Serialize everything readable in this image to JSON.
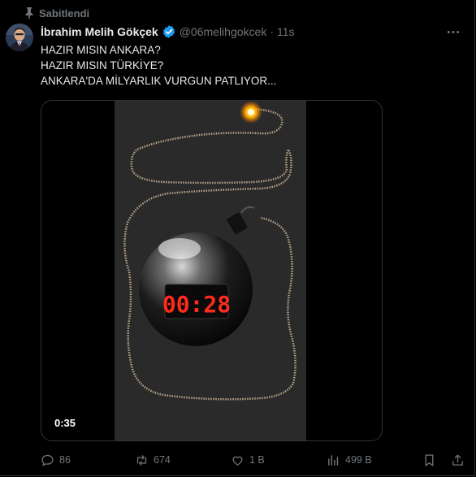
{
  "post": {
    "pinned_label": "Sabitlendi",
    "author_name": "İbrahim Melih Gökçek",
    "handle": "@06melihgokcek",
    "separator": "·",
    "time": "11s",
    "text_lines": [
      "HAZIR MISIN ANKARA?",
      "HAZIR MISIN TÜRKİYE?",
      "ANKARA'DA MİLYARLIK VURGUN PATLIYOR..."
    ]
  },
  "media": {
    "timer_display": "00:28",
    "duration": "0:35"
  },
  "actions": {
    "replies": "86",
    "reposts": "674",
    "likes": "1 B",
    "views": "499 B"
  },
  "icons": {
    "pin": "pin-icon",
    "verified": "verified-badge-icon",
    "more": "more-options-icon",
    "reply": "reply-icon",
    "repost": "repost-icon",
    "like": "like-icon",
    "views": "views-icon",
    "bookmark": "bookmark-icon",
    "share": "share-icon"
  },
  "colors": {
    "background": "#000000",
    "text_primary": "#e7e9ea",
    "text_secondary": "#71767b",
    "verified_blue": "#1d9bf0",
    "timer_red": "#ff2a1a",
    "border": "#2f3336"
  }
}
